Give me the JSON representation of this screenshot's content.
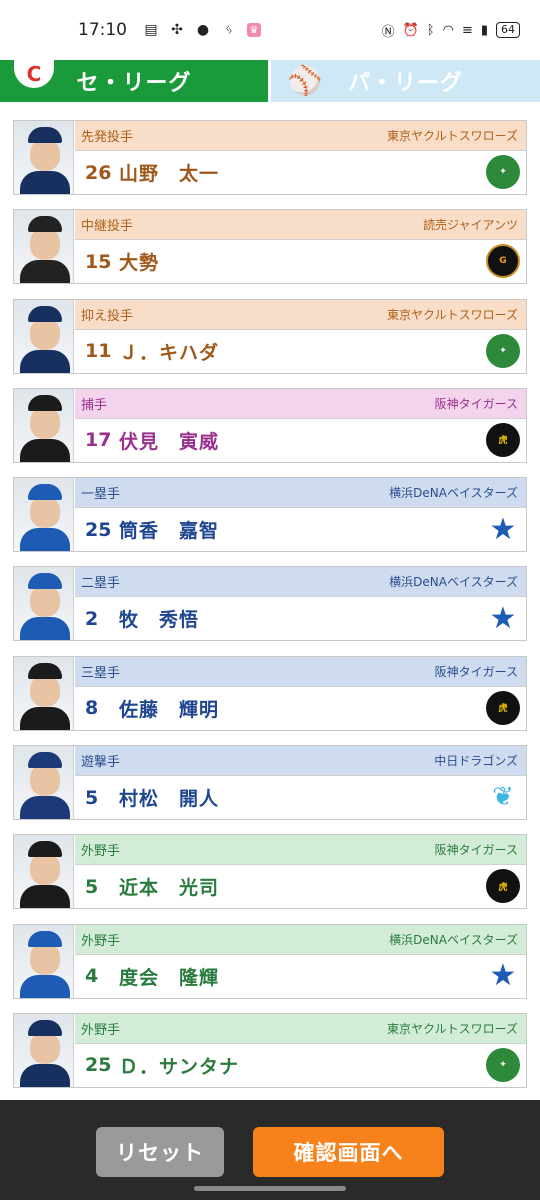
{
  "status": {
    "time": "17:10",
    "battery": "64"
  },
  "tabs": {
    "central": "セ・リーグ",
    "pacific": "パ・リーグ"
  },
  "players": [
    {
      "position": "先発投手",
      "team": "東京ヤクルトスワローズ",
      "number": "26",
      "name": "山野　太一",
      "theme": "pitcher",
      "club": "swallows"
    },
    {
      "position": "中継投手",
      "team": "読売ジャイアンツ",
      "number": "15",
      "name": "大勢",
      "theme": "pitcher",
      "club": "giants"
    },
    {
      "position": "抑え投手",
      "team": "東京ヤクルトスワローズ",
      "number": "11",
      "name": "Ｊ．キハダ",
      "theme": "pitcher",
      "club": "swallows"
    },
    {
      "position": "捕手",
      "team": "阪神タイガース",
      "number": "17",
      "name": "伏見　寅威",
      "theme": "catcher",
      "club": "tigers"
    },
    {
      "position": "一塁手",
      "team": "横浜DeNAベイスターズ",
      "number": "25",
      "name": "筒香　嘉智",
      "theme": "infield",
      "club": "baystars"
    },
    {
      "position": "二塁手",
      "team": "横浜DeNAベイスターズ",
      "number": "2",
      "name": "牧　秀悟",
      "theme": "infield",
      "club": "baystars"
    },
    {
      "position": "三塁手",
      "team": "阪神タイガース",
      "number": "8",
      "name": "佐藤　輝明",
      "theme": "infield",
      "club": "tigers"
    },
    {
      "position": "遊撃手",
      "team": "中日ドラゴンズ",
      "number": "5",
      "name": "村松　開人",
      "theme": "infield",
      "club": "dragons"
    },
    {
      "position": "外野手",
      "team": "阪神タイガース",
      "number": "5",
      "name": "近本　光司",
      "theme": "outfield",
      "club": "tigers"
    },
    {
      "position": "外野手",
      "team": "横浜DeNAベイスターズ",
      "number": "4",
      "name": "度会　隆輝",
      "theme": "outfield",
      "club": "baystars"
    },
    {
      "position": "外野手",
      "team": "東京ヤクルトスワローズ",
      "number": "25",
      "name": "Ｄ．サンタナ",
      "theme": "outfield",
      "club": "swallows"
    }
  ],
  "buttons": {
    "reset": "リセット",
    "confirm": "確認画面へ"
  },
  "colors": {
    "central_tab": "#1a9a3a",
    "pacific_tab": "#cfe8f6",
    "confirm_button": "#f7821b",
    "reset_button": "#9a9a9a"
  }
}
